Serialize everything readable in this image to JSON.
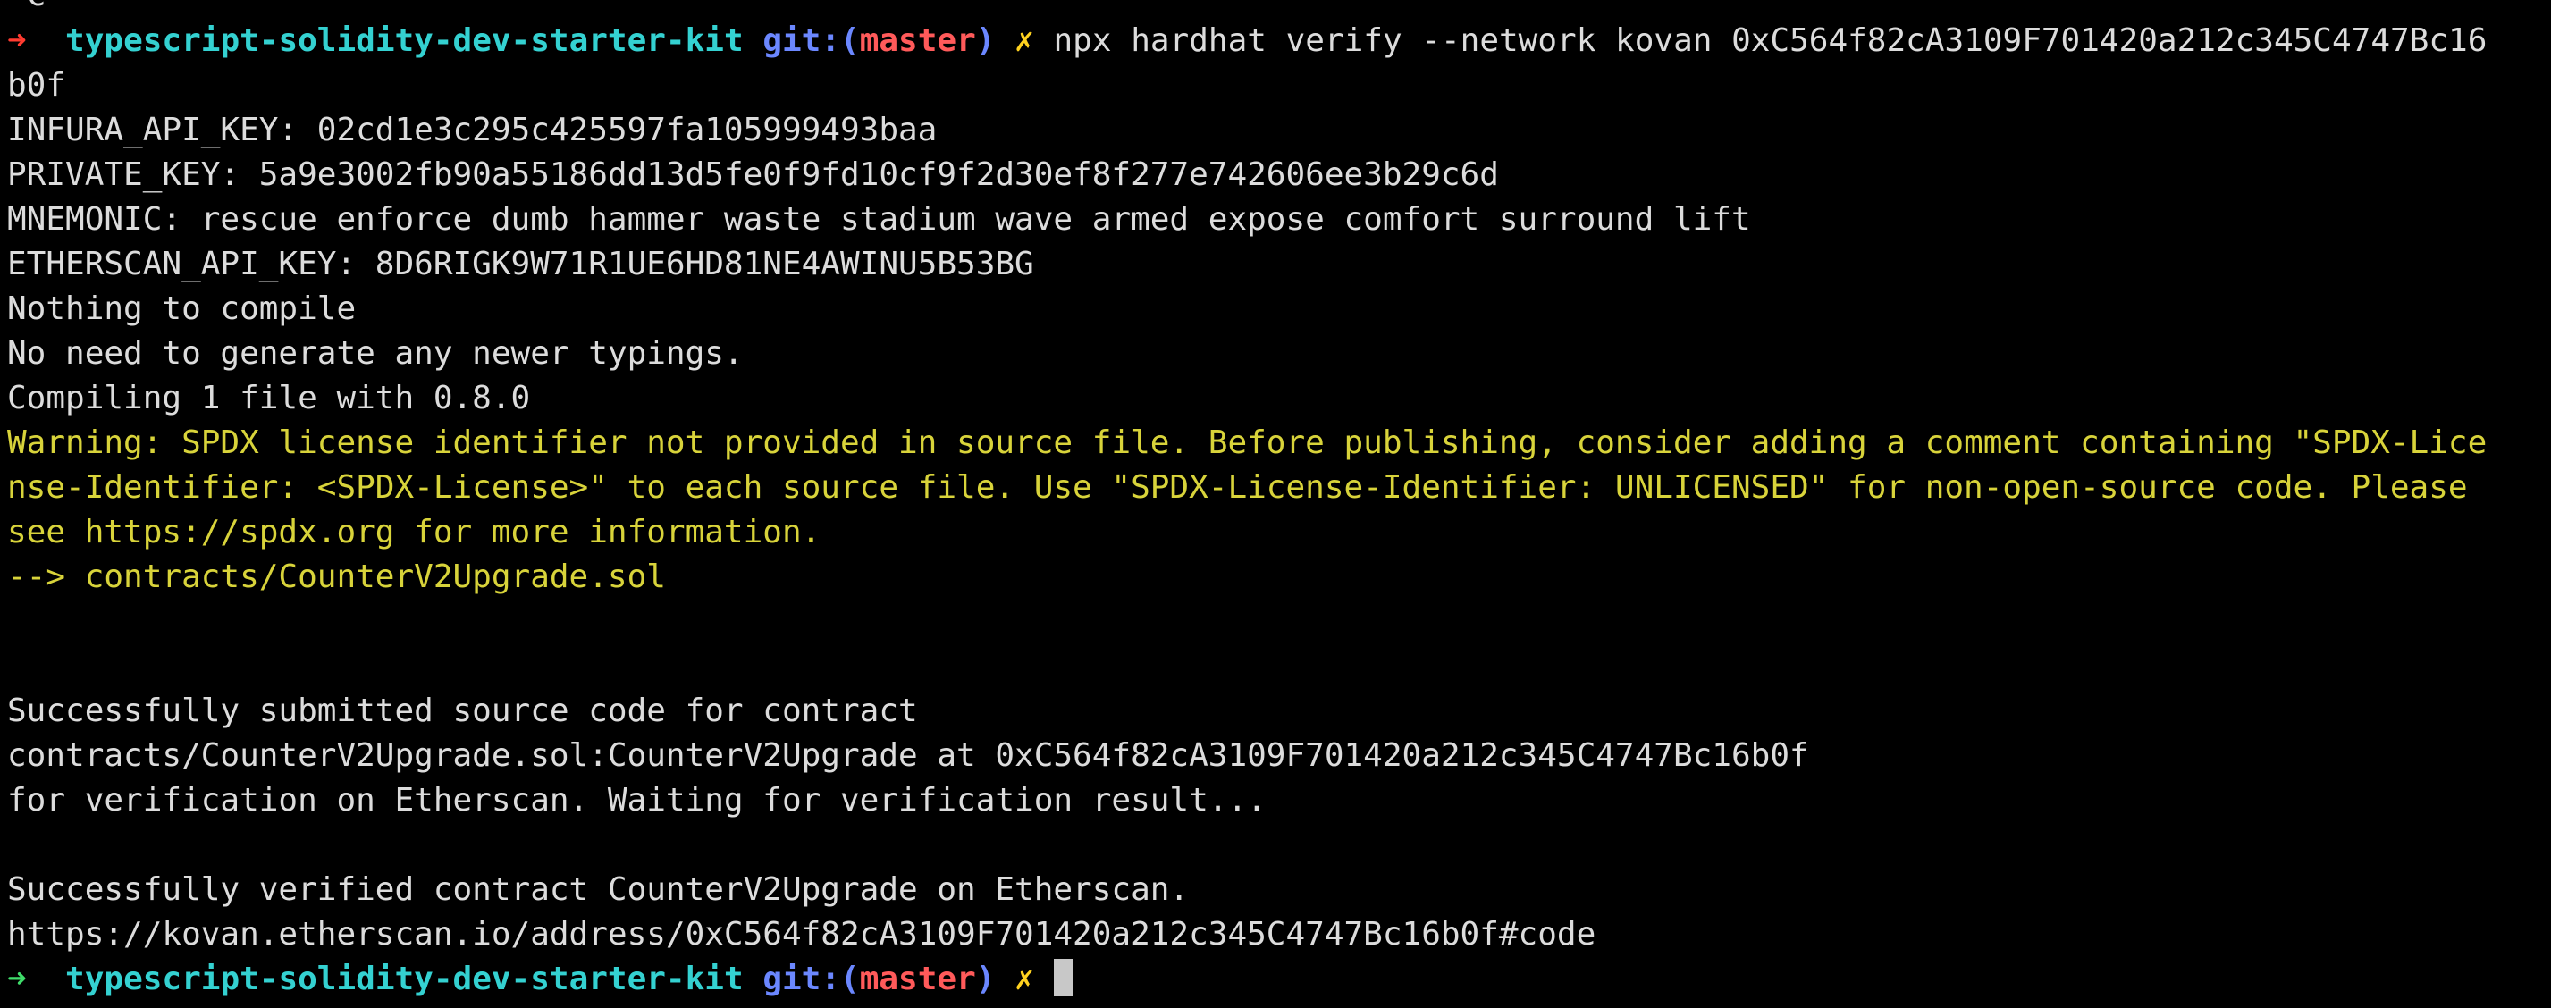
{
  "prompt": {
    "arrow": "➜",
    "directory": "typescript-solidity-dev-starter-kit",
    "git_label": "git:(",
    "branch": "master",
    "git_close": ")",
    "dirty_mark": "✗"
  },
  "top_clipped": "^C",
  "command": "npx hardhat verify --network kovan 0xC564f82cA3109F701420a212c345C4747Bc16",
  "command_wrap": "b0f",
  "output": [
    "INFURA_API_KEY: 02cd1e3c295c425597fa105999493baa",
    "PRIVATE_KEY: 5a9e3002fb90a55186dd13d5fe0f9fd10cf9f2d30ef8f277e742606ee3b29c6d",
    "MNEMONIC: rescue enforce dumb hammer waste stadium wave armed expose comfort surround lift",
    "ETHERSCAN_API_KEY: 8D6RIGK9W71R1UE6HD81NE4AWINU5B53BG",
    "Nothing to compile",
    "No need to generate any newer typings.",
    "Compiling 1 file with 0.8.0"
  ],
  "warning": [
    "Warning: SPDX license identifier not provided in source file. Before publishing, consider adding a comment containing \"SPDX-Lice",
    "nse-Identifier: <SPDX-License>\" to each source file. Use \"SPDX-License-Identifier: UNLICENSED\" for non-open-source code. Please",
    "see https://spdx.org for more information.",
    "--> contracts/CounterV2Upgrade.sol"
  ],
  "result": [
    "Successfully submitted source code for contract",
    "contracts/CounterV2Upgrade.sol:CounterV2Upgrade at 0xC564f82cA3109F701420a212c345C4747Bc16b0f",
    "for verification on Etherscan. Waiting for verification result...",
    "",
    "Successfully verified contract CounterV2Upgrade on Etherscan.",
    "https://kovan.etherscan.io/address/0xC564f82cA3109F701420a212c345C4747Bc16b0f#code"
  ],
  "colors": {
    "background": "#000000",
    "text": "#dcdcdc",
    "arrow_error": "#ff3b30",
    "arrow_ok": "#3fdc6a",
    "directory": "#34d1d1",
    "git": "#6b87ff",
    "branch": "#ff5a5a",
    "dirty": "#ffd21f",
    "warning": "#d8d33a"
  }
}
